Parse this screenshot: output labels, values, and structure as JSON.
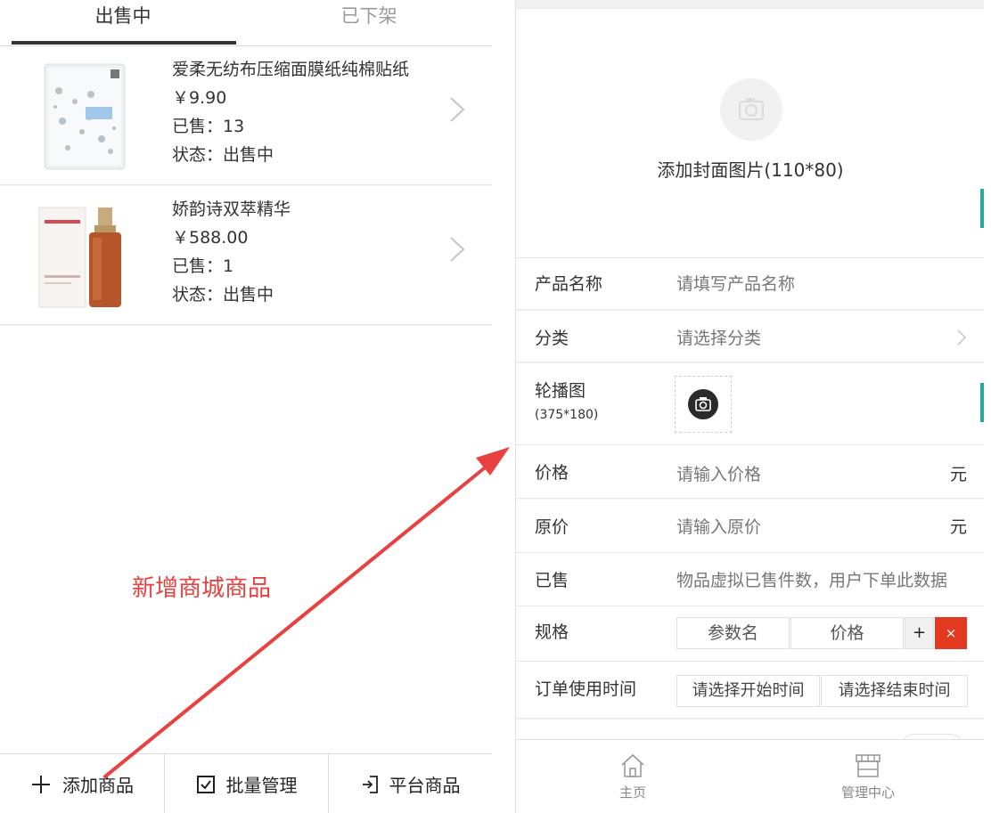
{
  "left_screen": {
    "tabs": [
      {
        "label": "出售中",
        "active": true
      },
      {
        "label": "已下架",
        "active": false
      }
    ],
    "products": [
      {
        "name": "爱柔无纺布压缩面膜纸纯棉贴纸",
        "price": "￥9.90",
        "sold": "已售：13",
        "status": "状态：出售中"
      },
      {
        "name": "娇韵诗双萃精华",
        "price": "￥588.00",
        "sold": "已售：1",
        "status": "状态：出售中"
      }
    ],
    "annotation": "新增商城商品",
    "bottom_bar": {
      "add_label": "添加商品",
      "batch_label": "批量管理",
      "platform_label": "平台商品"
    }
  },
  "right_screen": {
    "cover_label": "添加封面图片(110*80)",
    "form": {
      "name_label": "产品名称",
      "name_placeholder": "请填写产品名称",
      "category_label": "分类",
      "category_placeholder": "请选择分类",
      "carousel_label": "轮播图",
      "carousel_size": "(375*180)",
      "price_label": "价格",
      "price_placeholder": "请输入价格",
      "price_unit": "元",
      "orig_label": "原价",
      "orig_placeholder": "请输入原价",
      "orig_unit": "元",
      "sold_label": "已售",
      "sold_placeholder": "物品虚拟已售件数，用户下单此数据",
      "spec_label": "规格",
      "spec_name": "参数名",
      "spec_price": "价格",
      "spec_add": "+",
      "spec_remove": "×",
      "time_label": "订单使用时间",
      "time_start": "请选择开始时间",
      "time_end": "请选择结束时间"
    },
    "tabbar": {
      "home_label": "主页",
      "mgmt_label": "管理中心"
    }
  },
  "colors": {
    "arrow": "#e8413f",
    "remove_button": "#e2391f",
    "tab_active": "#333333",
    "tab_inactive": "#9a9a9a"
  }
}
